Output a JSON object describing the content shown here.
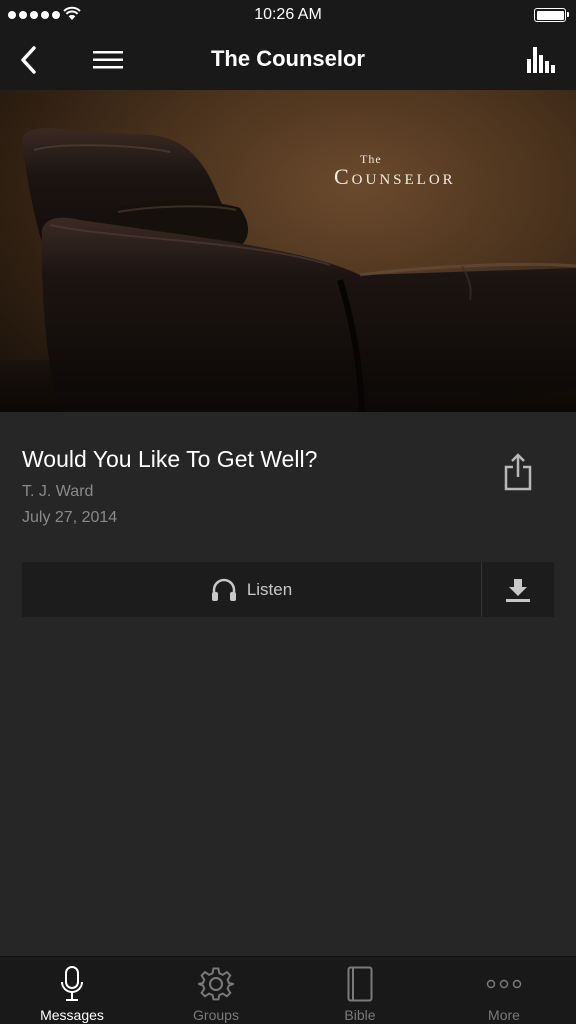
{
  "status_bar": {
    "time": "10:26 AM"
  },
  "nav": {
    "title": "The Counselor",
    "back_icon": "chevron-left-icon",
    "menu_icon": "hamburger-icon",
    "stats_icon": "bar-chart-icon"
  },
  "hero": {
    "title_small": "The",
    "title_big": "Counselor"
  },
  "message": {
    "title": "Would You Like To Get Well?",
    "speaker": "T. J. Ward",
    "date": "July 27, 2014"
  },
  "actions": {
    "listen_label": "Listen"
  },
  "tabs": [
    {
      "label": "Messages",
      "icon": "microphone-icon",
      "active": true
    },
    {
      "label": "Groups",
      "icon": "gear-icon",
      "active": false
    },
    {
      "label": "Bible",
      "icon": "book-icon",
      "active": false
    },
    {
      "label": "More",
      "icon": "more-dots-icon",
      "active": false
    }
  ],
  "colors": {
    "background": "#262626",
    "bar": "#191919",
    "secondary_text": "#8a8a8a"
  }
}
